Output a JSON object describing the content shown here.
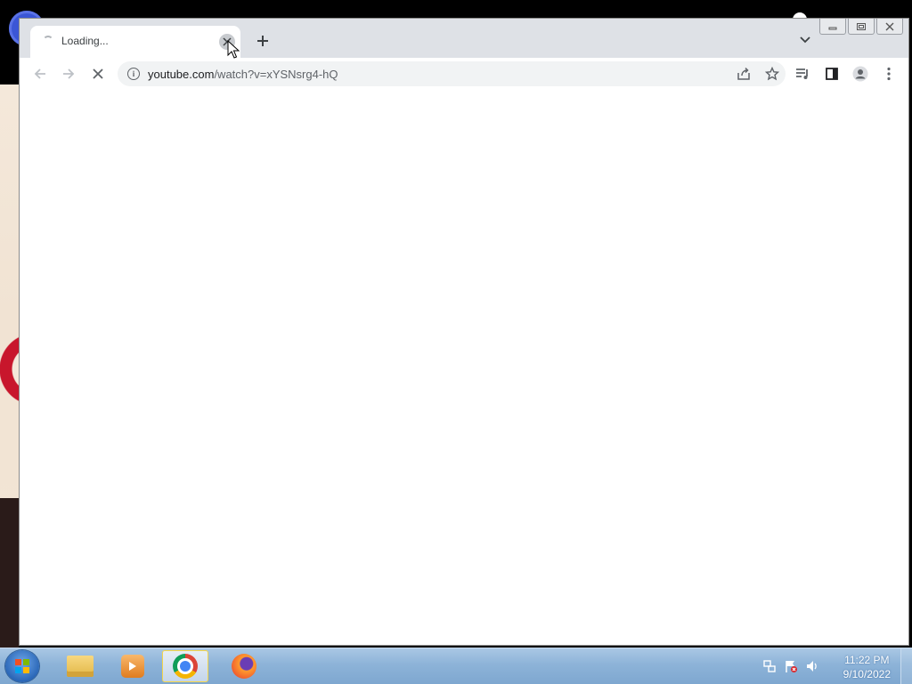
{
  "browser": {
    "tab": {
      "title": "Loading..."
    },
    "address_bar": {
      "domain": "youtube.com",
      "path": "/watch?v=xYSNsrg4-hQ"
    }
  },
  "taskbar": {
    "clock": {
      "time": "11:22 PM",
      "date": "9/10/2022"
    },
    "apps": [
      {
        "name": "Windows Explorer",
        "icon": "folder-icon"
      },
      {
        "name": "Windows Media Player",
        "icon": "media-player-icon"
      },
      {
        "name": "Google Chrome",
        "icon": "chrome-icon",
        "active": true
      },
      {
        "name": "Firefox",
        "icon": "firefox-icon"
      }
    ]
  },
  "colors": {
    "tabstrip": "#dee1e6",
    "omnibox": "#f1f3f4",
    "taskbar": "#8db3d8"
  }
}
